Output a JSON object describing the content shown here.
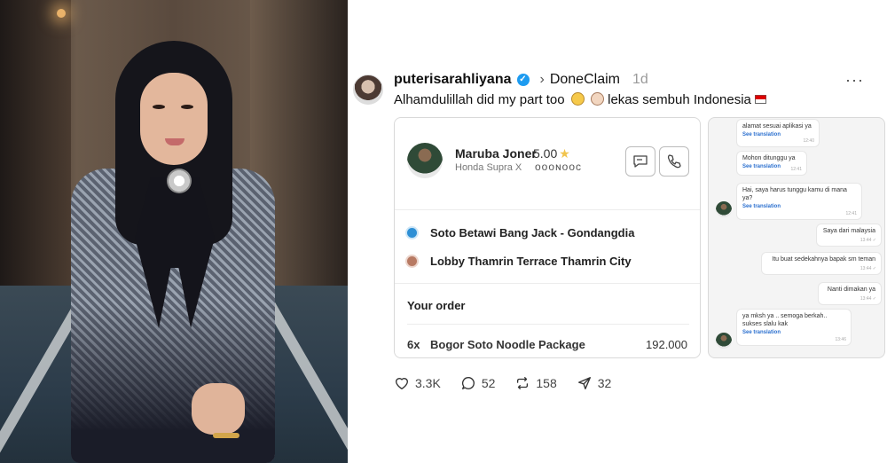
{
  "post": {
    "username": "puterisarahliyana",
    "channel": "DoneClaim",
    "time": "1d",
    "caption": "Alhamdulillah did my part too",
    "caption_tail": "lekas sembuh Indonesia",
    "more": "···"
  },
  "order": {
    "driver_name": "Maruba Joner",
    "rating": "5.00",
    "vehicle": "Honda Supra X",
    "plate": "ᴏᴏᴏɴᴏᴏᴄ",
    "pickup": "Soto Betawi Bang Jack - Gondangdia",
    "dropoff": "Lobby Thamrin Terrace Thamrin City",
    "your_order_label": "Your order",
    "item_qty": "6x",
    "item_name": "Bogor Soto Noodle Package",
    "item_price": "192.000"
  },
  "chat": {
    "messages": [
      {
        "text": "alamat sesuai aplikasi ya",
        "translate": "See translation",
        "time": "12:40",
        "dir": "in"
      },
      {
        "text": "Mohon ditunggu ya",
        "translate": "See translation",
        "time": "12:41",
        "dir": "in"
      },
      {
        "text": "Hai, saya harus tunggu kamu di mana ya?",
        "translate": "See translation",
        "time": "12:41",
        "dir": "in"
      },
      {
        "text": "Saya dari malaysia",
        "time": "13:44 ✓",
        "dir": "out"
      },
      {
        "text": "Itu buat sedekahnya bapak sm teman",
        "time": "13:44 ✓",
        "dir": "out"
      },
      {
        "text": "Nanti dimakan ya",
        "time": "13:44 ✓",
        "dir": "out"
      },
      {
        "text": "ya mksh ya .. semoga berkah.. sukses slalu kak",
        "translate": "See translation",
        "time": "13:46",
        "dir": "in"
      }
    ]
  },
  "actions": {
    "likes": "3.3K",
    "comments": "52",
    "reposts": "158",
    "shares": "32"
  },
  "colors": {
    "verified": "#1d9bf0",
    "pickup_dot": "#2d8fd5",
    "dropoff_dot": "#b87a63",
    "translation_link": "#2a6fcf"
  }
}
